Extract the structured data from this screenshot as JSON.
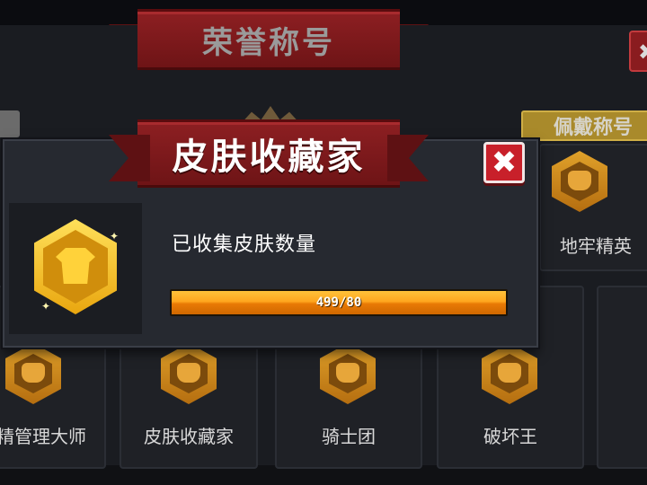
{
  "background": {
    "title": "荣誉称号",
    "close_label": "✖",
    "wear_button_label": "佩戴称号",
    "titles": [
      {
        "label": "地牢精英",
        "icon": "dungeon-elite-badge-icon"
      },
      {
        "label": "精管理大师",
        "icon": "management-master-badge-icon"
      },
      {
        "label": "皮肤收藏家",
        "icon": "skin-collector-badge-icon"
      },
      {
        "label": "骑士团",
        "icon": "knights-badge-icon"
      },
      {
        "label": "破坏王",
        "icon": "destroyer-badge-icon"
      }
    ]
  },
  "modal": {
    "title": "皮肤收藏家",
    "close_label": "✖",
    "icon": "skin-collector-badge-icon",
    "progress": {
      "label": "已收集皮肤数量",
      "text": "499/80",
      "fraction": 1.0
    }
  },
  "colors": {
    "ribbon": "#7a1a1c",
    "progress_fill": "#ffa61e",
    "badge_gold": "#e9a60f",
    "close_red": "#c8202a"
  }
}
